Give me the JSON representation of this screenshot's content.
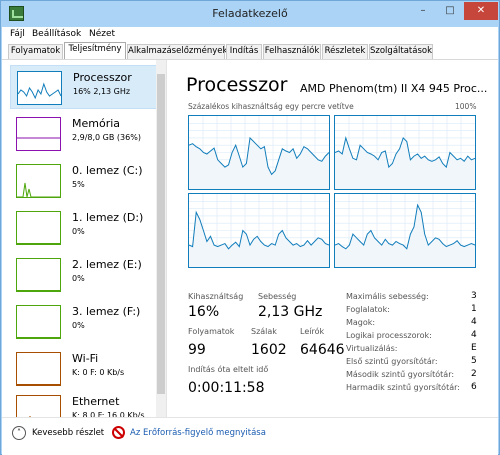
{
  "window": {
    "title": "Feladatkezelő",
    "minimize": "–",
    "maximize": "□",
    "close": "✕"
  },
  "menu": [
    "Fájl",
    "Beállítások",
    "Nézet"
  ],
  "tabs": [
    "Folyamatok",
    "Teljesítmény",
    "Alkalmazáselőzmények",
    "Indítás",
    "Felhasználók",
    "Részletek",
    "Szolgáltatások"
  ],
  "active_tab": "Teljesítmény",
  "sidebar": [
    {
      "title": "Processzor",
      "sub": "16% 2,13 GHz",
      "color": "#117dbb",
      "icon": "cpu-thumbnail"
    },
    {
      "title": "Memória",
      "sub": "2,9/8,0 GB (36%)",
      "color": "#8b12ae",
      "icon": "memory-thumbnail"
    },
    {
      "title": "0. lemez (C:)",
      "sub": "5%",
      "color": "#4da60c",
      "icon": "disk-thumbnail"
    },
    {
      "title": "1. lemez (D:)",
      "sub": "0%",
      "color": "#4da60c",
      "icon": "disk-thumbnail"
    },
    {
      "title": "2. lemez (E:)",
      "sub": "0%",
      "color": "#4da60c",
      "icon": "disk-thumbnail"
    },
    {
      "title": "3. lemez (F:)",
      "sub": "0%",
      "color": "#4da60c",
      "icon": "disk-thumbnail"
    },
    {
      "title": "Wi-Fi",
      "sub": "K: 0 F: 0 Kb/s",
      "color": "#a74f01",
      "icon": "network-thumbnail"
    },
    {
      "title": "Ethernet",
      "sub": "K: 8,0 F: 16,0 Kb/s",
      "color": "#a74f01",
      "icon": "network-thumbnail"
    }
  ],
  "panel": {
    "title": "Processzor",
    "cpu_name": "AMD Phenom(tm) II X4 945 Proc...",
    "graph_label": "Százalékos kihasználtság egy percre vetítve",
    "graph_max": "100%",
    "graph_color": "#117dbb",
    "graph_fill": "#f1f6fa",
    "stats": {
      "utilization_label": "Kihasználtság",
      "utilization": "16%",
      "speed_label": "Sebesség",
      "speed": "2,13 GHz",
      "processes_label": "Folyamatok",
      "processes": "99",
      "threads_label": "Szálak",
      "threads": "1602",
      "handles_label": "Leírók",
      "handles": "64646",
      "uptime_label": "Indítás óta eltelt idő",
      "uptime": "0:00:11:58"
    },
    "info": [
      {
        "label": "Maximális sebesség:",
        "value": "3"
      },
      {
        "label": "Foglalatok:",
        "value": "1"
      },
      {
        "label": "Magok:",
        "value": "4"
      },
      {
        "label": "Logikai processzorok:",
        "value": "4"
      },
      {
        "label": "Virtualizálás:",
        "value": "E"
      },
      {
        "label": "Első szintű gyorsítótár:",
        "value": "5"
      },
      {
        "label": "Második szintű gyorsítótár:",
        "value": "2"
      },
      {
        "label": "Harmadik szintű gyorsítótár:",
        "value": "6"
      }
    ]
  },
  "cores": [
    [
      60,
      62,
      58,
      55,
      50,
      48,
      52,
      56,
      40,
      35,
      30,
      33,
      50,
      60,
      45,
      30,
      35,
      70,
      65,
      60,
      55,
      58,
      30,
      20,
      25,
      40,
      55,
      52,
      50,
      55,
      42,
      48,
      58,
      55,
      50,
      45,
      40,
      38,
      45,
      50
    ],
    [
      50,
      52,
      48,
      70,
      55,
      42,
      40,
      60,
      55,
      50,
      48,
      45,
      40,
      50,
      52,
      30,
      35,
      48,
      55,
      70,
      65,
      40,
      45,
      48,
      42,
      45,
      40,
      38,
      40,
      44,
      35,
      30,
      50,
      45,
      40,
      42,
      38,
      45,
      40,
      42
    ],
    [
      30,
      28,
      75,
      65,
      50,
      35,
      42,
      30,
      28,
      30,
      32,
      25,
      30,
      34,
      28,
      50,
      45,
      30,
      38,
      42,
      35,
      30,
      28,
      32,
      30,
      45,
      50,
      40,
      35,
      30,
      32,
      28,
      30,
      36,
      30,
      35,
      40,
      38,
      32,
      30
    ],
    [
      30,
      32,
      28,
      25,
      30,
      45,
      40,
      35,
      30,
      45,
      50,
      40,
      35,
      30,
      38,
      32,
      30,
      35,
      32,
      30,
      25,
      45,
      55,
      85,
      75,
      45,
      30,
      35,
      40,
      38,
      32,
      28,
      30,
      32,
      36,
      30,
      28,
      30,
      32,
      30
    ]
  ],
  "footer": {
    "fewer": "Kevesebb részlet",
    "fewer_icon": "chevron-up-icon",
    "link": "Az Erőforrás-figyelő megnyitása",
    "link_icon": "resource-monitor-icon"
  }
}
